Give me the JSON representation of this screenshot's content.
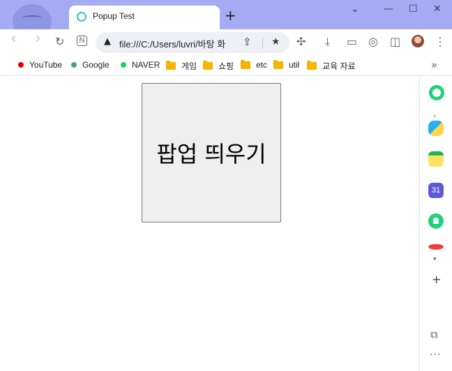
{
  "tab": {
    "title": "Popup Test",
    "new_tab_label": "+"
  },
  "window_controls": {
    "chevron": "⌄",
    "minimize": "—",
    "maximize": "☐",
    "close": "✕"
  },
  "toolbar": {
    "back": "‹",
    "forward": "›",
    "reload": "↻",
    "notion": "N",
    "url": "file:///C:/Users/luvri/바탕 화",
    "security_icon": "▲",
    "share_icon": "⇪",
    "bookmark_star_icon": "★",
    "extensions_icon": "✣",
    "download_icon": "⤓",
    "camera_icon": "▭",
    "screenshot_icon": "◎",
    "split_icon": "◫",
    "menu_icon": "⋮"
  },
  "bookmarks": {
    "items": [
      {
        "label": "YouTube",
        "type": "site",
        "color": "#e00000"
      },
      {
        "label": "Google",
        "type": "site",
        "color": "#4f9a8f"
      },
      {
        "label": "NAVER",
        "type": "site",
        "color": "#1fd16a"
      },
      {
        "label": "게임",
        "type": "folder"
      },
      {
        "label": "쇼핑",
        "type": "folder"
      },
      {
        "label": "etc",
        "type": "folder"
      },
      {
        "label": "util",
        "type": "folder"
      },
      {
        "label": "교육 자료",
        "type": "folder"
      }
    ],
    "more": "»"
  },
  "content": {
    "popup_button_label": "팝업 띄우기"
  },
  "side_panel": {
    "calendar_day": "31",
    "scroll_down": "▾",
    "scroll_up": "▴",
    "add": "+",
    "external": "⧉",
    "more": "···"
  }
}
